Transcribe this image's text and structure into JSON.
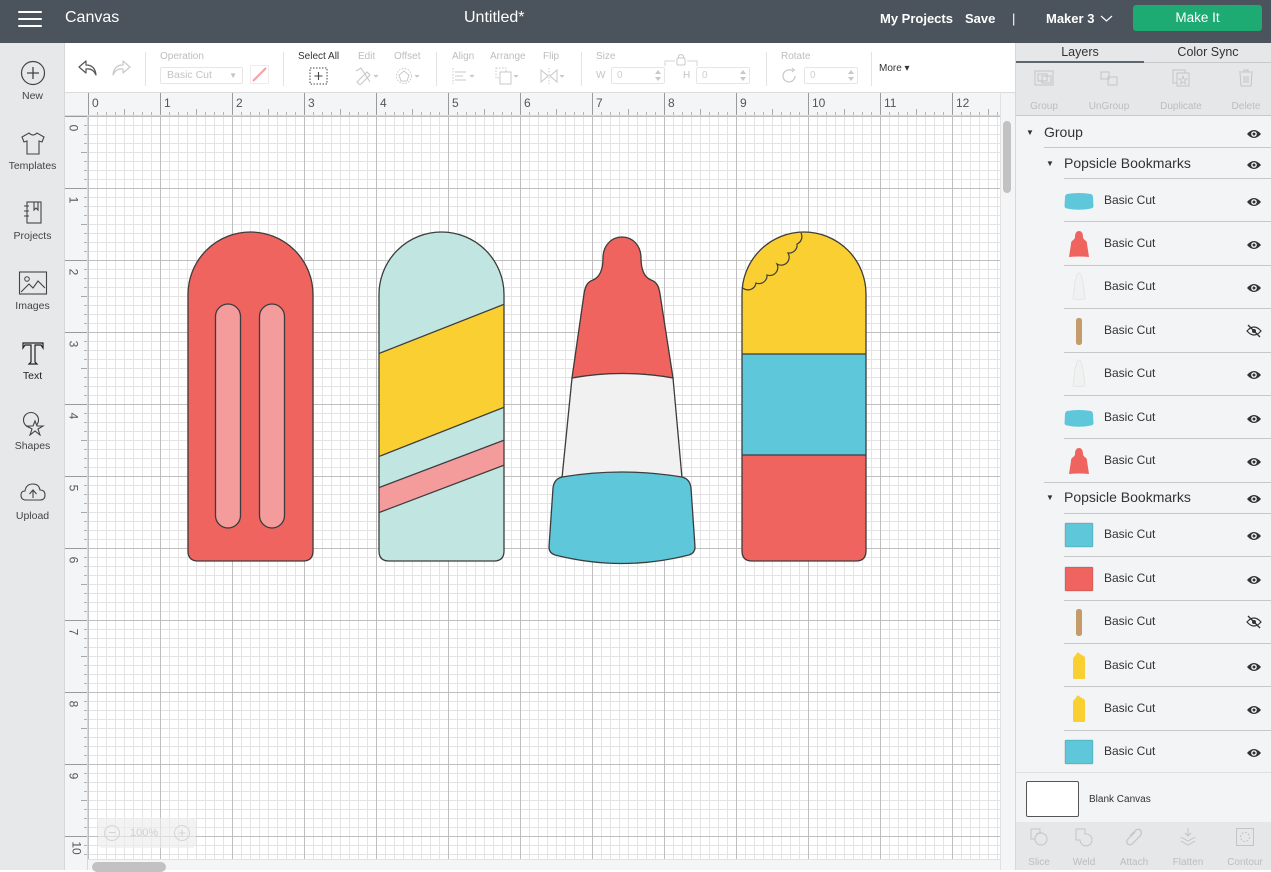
{
  "app": {
    "title": "Canvas",
    "document_title": "Untitled*"
  },
  "topbar": {
    "my_projects": "My Projects",
    "save": "Save",
    "separator": "|",
    "machine": "Maker 3",
    "make_it": "Make It",
    "make_it_color": "#1DAA73"
  },
  "sidebar": {
    "items": [
      {
        "label": "New",
        "icon": "plus-circle-icon"
      },
      {
        "label": "Templates",
        "icon": "tshirt-icon"
      },
      {
        "label": "Projects",
        "icon": "notebook-icon"
      },
      {
        "label": "Images",
        "icon": "image-icon"
      },
      {
        "label": "Text",
        "icon": "text-icon"
      },
      {
        "label": "Shapes",
        "icon": "shapes-icon"
      },
      {
        "label": "Upload",
        "icon": "cloud-upload-icon"
      }
    ]
  },
  "toolbar": {
    "operation_label": "Operation",
    "operation_value": "Basic Cut",
    "select_all": "Select All",
    "edit": "Edit",
    "offset": "Offset",
    "align": "Align",
    "arrange": "Arrange",
    "flip": "Flip",
    "size": "Size",
    "w_label": "W",
    "w_value": "0",
    "h_label": "H",
    "h_value": "0",
    "rotate": "Rotate",
    "rotate_value": "0",
    "more": "More ▾"
  },
  "rulers": {
    "x": [
      "0",
      "1",
      "2",
      "3",
      "4",
      "5",
      "6",
      "7",
      "8",
      "9",
      "10",
      "11",
      "12"
    ],
    "y": [
      "0",
      "1",
      "2",
      "3",
      "4",
      "5",
      "6",
      "7",
      "8",
      "9",
      "10"
    ]
  },
  "zoom": {
    "minus": "−",
    "level": "100%",
    "plus": "+"
  },
  "canvas": {
    "colors": {
      "red": "#F0645F",
      "pink": "#F49C9B",
      "mint": "#C1E5E1",
      "yellow": "#F9CF32",
      "blue": "#5FC7DA",
      "white": "#F1F1F1",
      "outline": "#3C3C3C"
    }
  },
  "panel": {
    "tabs": {
      "layers": "Layers",
      "color_sync": "Color Sync"
    },
    "actions": {
      "group": "Group",
      "ungroup": "UnGroup",
      "duplicate": "Duplicate",
      "delete": "Delete"
    },
    "layers": {
      "root": {
        "label": "Group",
        "visible": true
      },
      "groups": [
        {
          "label": "Popsicle Bookmarks",
          "visible": true,
          "items": [
            {
              "label": "Basic Cut",
              "thumb": "rocket-base",
              "color": "#5FC7DA",
              "visible": true
            },
            {
              "label": "Basic Cut",
              "thumb": "rocket-tip",
              "color": "#F0645F",
              "visible": true
            },
            {
              "label": "Basic Cut",
              "thumb": "rocket-body",
              "color": "#F1F1F1",
              "visible": true
            },
            {
              "label": "Basic Cut",
              "thumb": "stick",
              "color": "#C49B6B",
              "visible": false
            },
            {
              "label": "Basic Cut",
              "thumb": "rocket-body",
              "color": "#F1F1F1",
              "visible": true
            },
            {
              "label": "Basic Cut",
              "thumb": "rocket-base",
              "color": "#5FC7DA",
              "visible": true
            },
            {
              "label": "Basic Cut",
              "thumb": "rocket-tip",
              "color": "#F0645F",
              "visible": true
            }
          ]
        },
        {
          "label": "Popsicle Bookmarks",
          "visible": true,
          "items": [
            {
              "label": "Basic Cut",
              "thumb": "square",
              "color": "#5FC7DA",
              "visible": true
            },
            {
              "label": "Basic Cut",
              "thumb": "square",
              "color": "#F0645F",
              "visible": true
            },
            {
              "label": "Basic Cut",
              "thumb": "stick",
              "color": "#C49B6B",
              "visible": false
            },
            {
              "label": "Basic Cut",
              "thumb": "bitten-top",
              "color": "#F9CF32",
              "visible": true
            },
            {
              "label": "Basic Cut",
              "thumb": "bitten-top",
              "color": "#F9CF32",
              "visible": true
            },
            {
              "label": "Basic Cut",
              "thumb": "square",
              "color": "#5FC7DA",
              "visible": true
            }
          ]
        }
      ]
    },
    "blank_canvas": "Blank Canvas",
    "tools": {
      "slice": "Slice",
      "weld": "Weld",
      "attach": "Attach",
      "flatten": "Flatten",
      "contour": "Contour"
    }
  }
}
